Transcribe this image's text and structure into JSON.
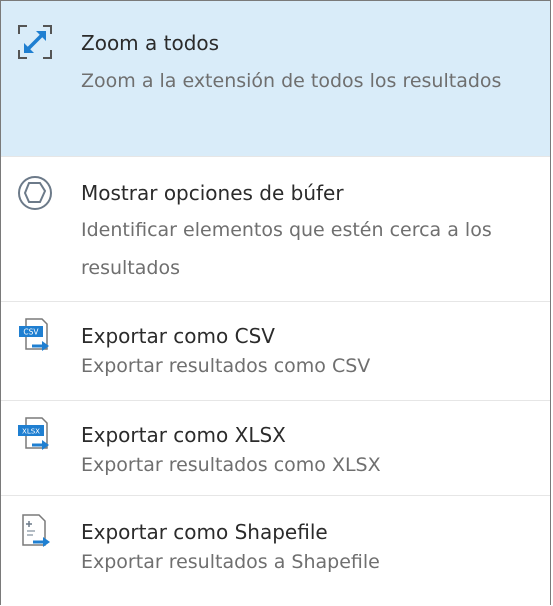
{
  "menu": {
    "items": [
      {
        "title": "Zoom a todos",
        "description": "Zoom a la extensión de todos los resultados",
        "icon": "zoom-extent-icon"
      },
      {
        "title": "Mostrar opciones de búfer",
        "description": "Identificar elementos que estén cerca a los resultados",
        "icon": "buffer-icon"
      },
      {
        "title": "Exportar como CSV",
        "description": "Exportar resultados como CSV",
        "icon": "export-csv-icon",
        "badge": "CSV"
      },
      {
        "title": "Exportar como XLSX",
        "description": "Exportar resultados como XLSX",
        "icon": "export-xlsx-icon",
        "badge": "XLSX"
      },
      {
        "title": "Exportar como Shapefile",
        "description": "Exportar resultados a Shapefile",
        "icon": "export-shapefile-icon"
      }
    ]
  },
  "colors": {
    "highlight": "#d9ecf9",
    "icon_blue": "#1f7fd1",
    "title_text": "#2b2b2b",
    "description_text": "#6f6f6f"
  }
}
